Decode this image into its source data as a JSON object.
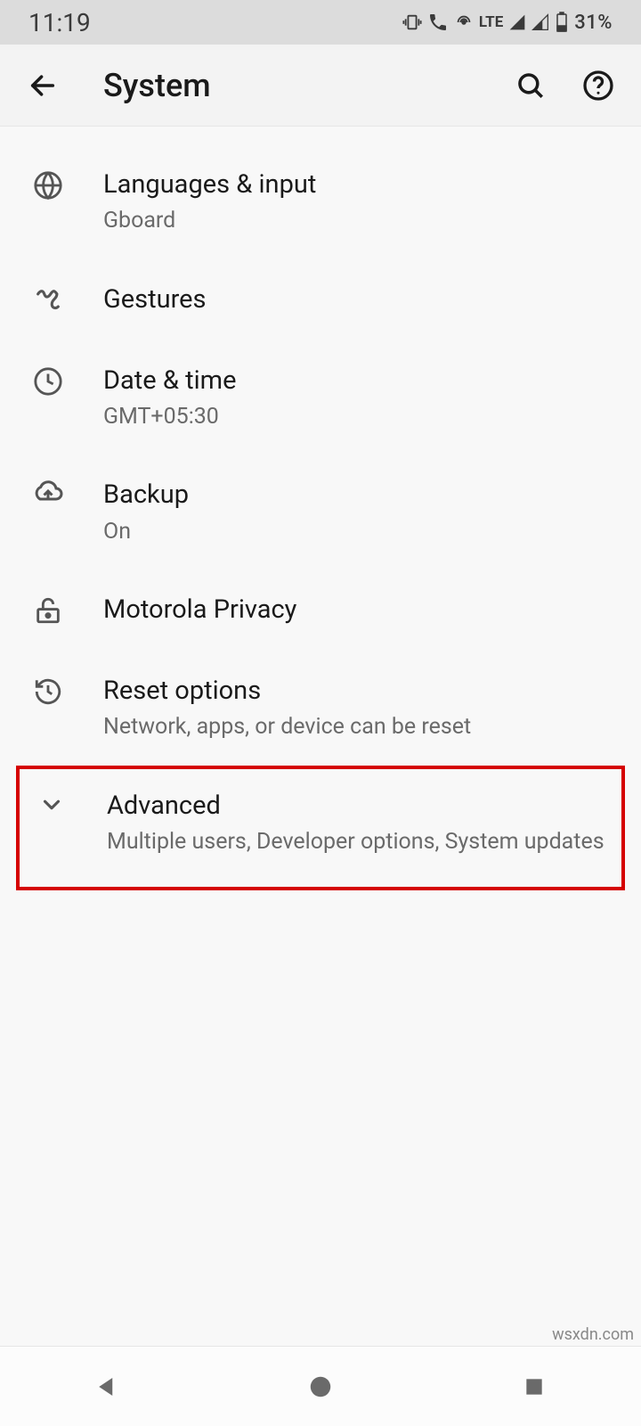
{
  "status": {
    "time": "11:19",
    "lte_label": "LTE",
    "battery_text": "31%"
  },
  "header": {
    "title": "System"
  },
  "items": [
    {
      "title": "Languages & input",
      "subtitle": "Gboard"
    },
    {
      "title": "Gestures",
      "subtitle": ""
    },
    {
      "title": "Date & time",
      "subtitle": "GMT+05:30"
    },
    {
      "title": "Backup",
      "subtitle": "On"
    },
    {
      "title": "Motorola Privacy",
      "subtitle": ""
    },
    {
      "title": "Reset options",
      "subtitle": "Network, apps, or device can be reset"
    },
    {
      "title": "Advanced",
      "subtitle": "Multiple users, Developer options, System updates"
    }
  ],
  "watermark": "wsxdn.com"
}
